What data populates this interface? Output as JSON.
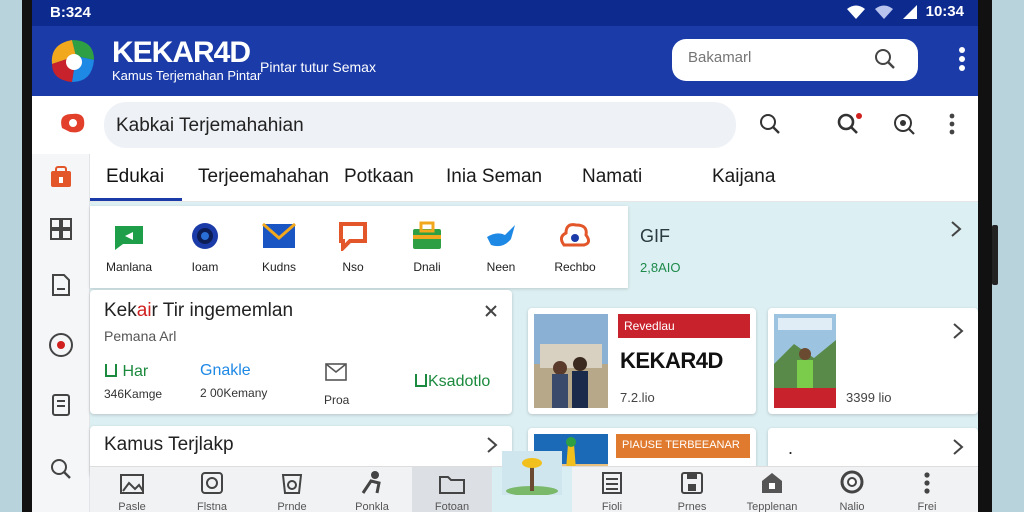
{
  "status_bar": {
    "time_left": "B:324",
    "time_right": "10:34"
  },
  "app_bar": {
    "brand": "KEKAR4D",
    "brand_subtitle": "Kamus Terjemahan Pintar",
    "tagline": "Pintar tutur Semax",
    "search_placeholder": "Bakamarl"
  },
  "search_row": {
    "query": "Kabkai Terjemahahian"
  },
  "tabs": [
    {
      "label": "Edukai",
      "active": true
    },
    {
      "label": "Terjeemahahan"
    },
    {
      "label": "Potkaan"
    },
    {
      "label": "Inia Seman"
    },
    {
      "label": "Namati"
    },
    {
      "label": "Kaijana"
    }
  ],
  "apps": [
    {
      "label": "Manlana",
      "icon": "green-chat-icon",
      "color": "#1e9e48"
    },
    {
      "label": "Ioam",
      "icon": "gear-icon",
      "color": "#1b3ba8"
    },
    {
      "label": "Kudns",
      "icon": "mail-icon",
      "color": "#1a55c4"
    },
    {
      "label": "Nso",
      "icon": "orange-chat-icon",
      "color": "#e2562a"
    },
    {
      "label": "Dnali",
      "icon": "briefcase-icon",
      "color": "#2ea043"
    },
    {
      "label": "Neen",
      "icon": "bird-icon",
      "color": "#1e88e5"
    },
    {
      "label": "Rechbo",
      "icon": "cloud-icon",
      "color": "#e2562a"
    }
  ],
  "gif_card": {
    "title": "GIF",
    "value": "2,8AIO"
  },
  "card_a": {
    "title_pre": "Kek",
    "title_hl": "ai",
    "title_post": "r Tir ingememlan",
    "subtitle": "Pemana Arl",
    "items": [
      {
        "title": "Har",
        "sub": "346Kamge"
      },
      {
        "title": "Gnakle",
        "sub": "2 00Kemany"
      },
      {
        "title": "",
        "sub": "Proa"
      },
      {
        "title": "Ksadotlo",
        "sub": ""
      }
    ]
  },
  "card_b": {
    "banner": "Revedlau",
    "headline": "KEKAR4D",
    "price": "7.2.lio"
  },
  "card_c": {
    "price": "3399 lio"
  },
  "card_d": {
    "title": "Kamus Terjlakp"
  },
  "card_e": {
    "banner": "PIAUSE TERBEEANAR"
  },
  "card_f": {
    "text": "."
  },
  "bottom_nav": [
    {
      "label": "Pasle",
      "icon": "image-icon"
    },
    {
      "label": "Flstna",
      "icon": "refresh-icon"
    },
    {
      "label": "Prnde",
      "icon": "bag-icon"
    },
    {
      "label": "Ponkla",
      "icon": "person-icon"
    },
    {
      "label": "Fotoan",
      "icon": "folder-icon",
      "active": true
    },
    {
      "label": "",
      "icon": "photo-icon"
    },
    {
      "label": "Fioli",
      "icon": "list-icon"
    },
    {
      "label": "Prnes",
      "icon": "save-icon"
    },
    {
      "label": "Tepplenan",
      "icon": "home-icon"
    },
    {
      "label": "Nalio",
      "icon": "circle-icon"
    },
    {
      "label": "Frei",
      "icon": "more-icon"
    }
  ],
  "colors": {
    "primary": "#1b3ba8",
    "status": "#0d2a8f",
    "content_bg": "#dceff2",
    "accent_red": "#c8232c",
    "accent_green": "#1c8a3e"
  }
}
